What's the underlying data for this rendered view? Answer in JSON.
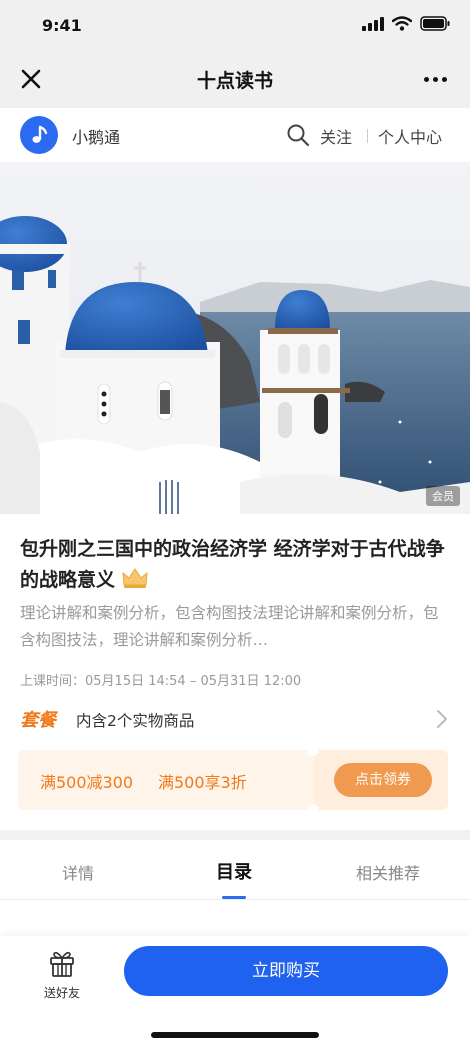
{
  "status": {
    "time": "9:41"
  },
  "header": {
    "title": "十点读书"
  },
  "brand": {
    "name": "小鹅通",
    "follow": "关注",
    "center": "个人中心"
  },
  "banner": {
    "badge": "会员"
  },
  "course": {
    "title": "包升刚之三国中的政治经济学 经济学对于古代战争的战略意义",
    "description": "理论讲解和案例分析，包含构图技法理论讲解和案例分析，包含构图技法，理论讲解和案例分析…",
    "time_label": "上课时间：",
    "time_value": "05月15日 14:54 – 05月31日 12:00"
  },
  "package": {
    "tag": "套餐",
    "text": "内含2个实物商品"
  },
  "coupon": {
    "offer_1": "满500减300",
    "offer_2": "满500享3折",
    "button": "点击领券"
  },
  "tabs": [
    {
      "label": "详情"
    },
    {
      "label": "目录"
    },
    {
      "label": "相关推荐"
    }
  ],
  "active_tab": "目录",
  "bottom": {
    "gift_label": "送好友",
    "buy_label": "立即购买"
  },
  "colors": {
    "primary": "#1f62ef",
    "accent": "#f07a1b",
    "coupon_bg": "#fff4ea"
  }
}
